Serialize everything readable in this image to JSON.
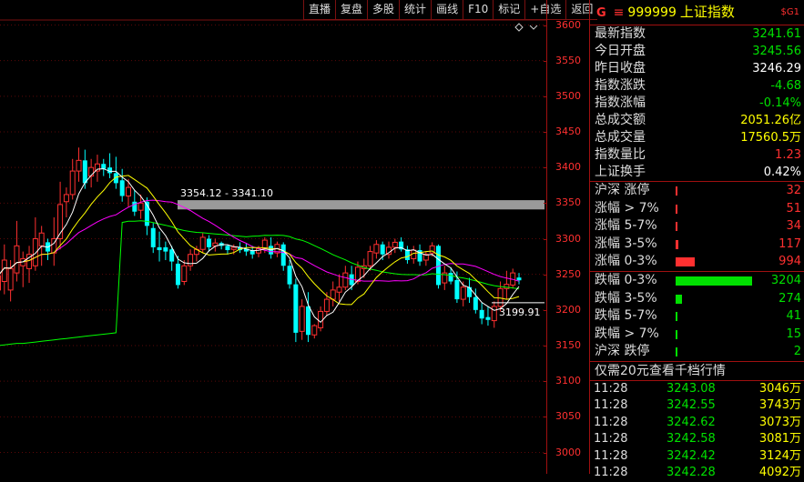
{
  "toolbar": [
    "直播",
    "复盘",
    "多股",
    "统计",
    "画线",
    "F10",
    "标记",
    "+自选",
    "返回"
  ],
  "header": {
    "g": "G",
    "eq": "≡",
    "code": "999999",
    "name": "上证指数",
    "tag": "$G1"
  },
  "quote": [
    {
      "label": "最新指数",
      "value": "3241.61",
      "color": "#00e000"
    },
    {
      "label": "今日开盘",
      "value": "3245.56",
      "color": "#00e000"
    },
    {
      "label": "昨日收盘",
      "value": "3246.29",
      "color": "#ffffff"
    },
    {
      "label": "指数涨跌",
      "value": "-4.68",
      "color": "#00e000"
    },
    {
      "label": "指数涨幅",
      "value": "-0.14%",
      "color": "#00e000"
    },
    {
      "label": "总成交额",
      "value": "2051.26亿",
      "color": "#ffff00"
    },
    {
      "label": "总成交量",
      "value": "17560.5万",
      "color": "#ffff00"
    },
    {
      "label": "指数量比",
      "value": "1.23",
      "color": "#ff3030"
    },
    {
      "label": "上证换手",
      "value": "0.42%",
      "color": "#ffffff"
    }
  ],
  "dist_up": [
    {
      "label": "沪深 涨停",
      "value": "32",
      "ratio": 0.0
    },
    {
      "label": "涨幅 > 7%",
      "value": "51",
      "ratio": 0.0
    },
    {
      "label": "涨幅 5-7%",
      "value": "34",
      "ratio": 0.0
    },
    {
      "label": "涨幅 3-5%",
      "value": "117",
      "ratio": 0.04
    },
    {
      "label": "涨幅 0-3%",
      "value": "994",
      "ratio": 0.25
    }
  ],
  "dist_down": [
    {
      "label": "跌幅 0-3%",
      "value": "3204",
      "ratio": 1.0
    },
    {
      "label": "跌幅 3-5%",
      "value": "274",
      "ratio": 0.08
    },
    {
      "label": "跌幅 5-7%",
      "value": "41",
      "ratio": 0.0
    },
    {
      "label": "跌幅 > 7%",
      "value": "15",
      "ratio": 0.0
    },
    {
      "label": "沪深 跌停",
      "value": "2",
      "ratio": 0.0
    }
  ],
  "banner": "仅需20元查看千档行情",
  "ticks": [
    {
      "time": "11:28",
      "price": "3243.08",
      "vol": "3046万"
    },
    {
      "time": "11:28",
      "price": "3242.55",
      "vol": "3743万"
    },
    {
      "time": "11:28",
      "price": "3242.62",
      "vol": "3073万"
    },
    {
      "time": "11:28",
      "price": "3242.58",
      "vol": "3081万"
    },
    {
      "time": "11:28",
      "price": "3242.42",
      "vol": "3124万"
    },
    {
      "time": "11:28",
      "price": "3242.28",
      "vol": "4092万"
    }
  ],
  "chart_data": {
    "type": "candlestick",
    "ylim": [
      2970,
      3630
    ],
    "y_ticks": [
      3000,
      3050,
      3100,
      3150,
      3200,
      3250,
      3300,
      3350,
      3400,
      3450,
      3500,
      3550,
      3600
    ],
    "band": {
      "label": "3354.12 - 3341.10",
      "high": 3354.12,
      "low": 3341.1
    },
    "last_low_label": "3199.91",
    "last_low": 3199.91,
    "colors": {
      "up": "#ff3030",
      "down": "#00ffff",
      "ma5": "#ffffff",
      "ma10": "#ffff00",
      "ma20": "#ff00ff",
      "ma60": "#00ff00"
    },
    "candles": [
      {
        "o": 3228,
        "h": 3262,
        "l": 3218,
        "c": 3248
      },
      {
        "o": 3240,
        "h": 3292,
        "l": 3222,
        "c": 3270
      },
      {
        "o": 3228,
        "h": 3270,
        "l": 3212,
        "c": 3258
      },
      {
        "o": 3252,
        "h": 3325,
        "l": 3240,
        "c": 3290
      },
      {
        "o": 3262,
        "h": 3282,
        "l": 3232,
        "c": 3272
      },
      {
        "o": 3258,
        "h": 3290,
        "l": 3238,
        "c": 3278
      },
      {
        "o": 3262,
        "h": 3330,
        "l": 3255,
        "c": 3300
      },
      {
        "o": 3290,
        "h": 3318,
        "l": 3262,
        "c": 3308
      },
      {
        "o": 3295,
        "h": 3300,
        "l": 3270,
        "c": 3282
      },
      {
        "o": 3280,
        "h": 3330,
        "l": 3262,
        "c": 3300
      },
      {
        "o": 3300,
        "h": 3380,
        "l": 3285,
        "c": 3348
      },
      {
        "o": 3352,
        "h": 3372,
        "l": 3330,
        "c": 3362
      },
      {
        "o": 3362,
        "h": 3412,
        "l": 3355,
        "c": 3395
      },
      {
        "o": 3395,
        "h": 3428,
        "l": 3380,
        "c": 3410
      },
      {
        "o": 3410,
        "h": 3425,
        "l": 3370,
        "c": 3378
      },
      {
        "o": 3388,
        "h": 3412,
        "l": 3372,
        "c": 3400
      },
      {
        "o": 3395,
        "h": 3418,
        "l": 3380,
        "c": 3405
      },
      {
        "o": 3405,
        "h": 3412,
        "l": 3388,
        "c": 3398
      },
      {
        "o": 3400,
        "h": 3420,
        "l": 3385,
        "c": 3392
      },
      {
        "o": 3392,
        "h": 3415,
        "l": 3370,
        "c": 3378
      },
      {
        "o": 3382,
        "h": 3398,
        "l": 3352,
        "c": 3360
      },
      {
        "o": 3360,
        "h": 3384,
        "l": 3345,
        "c": 3372
      },
      {
        "o": 3352,
        "h": 3368,
        "l": 3332,
        "c": 3338
      },
      {
        "o": 3340,
        "h": 3362,
        "l": 3328,
        "c": 3350
      },
      {
        "o": 3352,
        "h": 3358,
        "l": 3305,
        "c": 3318
      },
      {
        "o": 3315,
        "h": 3322,
        "l": 3280,
        "c": 3288
      },
      {
        "o": 3288,
        "h": 3310,
        "l": 3268,
        "c": 3284
      },
      {
        "o": 3288,
        "h": 3296,
        "l": 3270,
        "c": 3282
      },
      {
        "o": 3285,
        "h": 3290,
        "l": 3255,
        "c": 3268
      },
      {
        "o": 3265,
        "h": 3276,
        "l": 3230,
        "c": 3235
      },
      {
        "o": 3240,
        "h": 3270,
        "l": 3235,
        "c": 3262
      },
      {
        "o": 3262,
        "h": 3285,
        "l": 3255,
        "c": 3278
      },
      {
        "o": 3278,
        "h": 3290,
        "l": 3268,
        "c": 3285
      },
      {
        "o": 3285,
        "h": 3308,
        "l": 3280,
        "c": 3302
      },
      {
        "o": 3300,
        "h": 3305,
        "l": 3282,
        "c": 3288
      },
      {
        "o": 3290,
        "h": 3300,
        "l": 3282,
        "c": 3294
      },
      {
        "o": 3294,
        "h": 3296,
        "l": 3285,
        "c": 3290
      },
      {
        "o": 3290,
        "h": 3292,
        "l": 3278,
        "c": 3284
      },
      {
        "o": 3285,
        "h": 3292,
        "l": 3278,
        "c": 3288
      },
      {
        "o": 3288,
        "h": 3295,
        "l": 3280,
        "c": 3284
      },
      {
        "o": 3286,
        "h": 3294,
        "l": 3276,
        "c": 3282
      },
      {
        "o": 3284,
        "h": 3290,
        "l": 3272,
        "c": 3278
      },
      {
        "o": 3280,
        "h": 3290,
        "l": 3274,
        "c": 3286
      },
      {
        "o": 3286,
        "h": 3302,
        "l": 3280,
        "c": 3298
      },
      {
        "o": 3290,
        "h": 3302,
        "l": 3272,
        "c": 3278
      },
      {
        "o": 3280,
        "h": 3296,
        "l": 3274,
        "c": 3292
      },
      {
        "o": 3292,
        "h": 3295,
        "l": 3255,
        "c": 3262
      },
      {
        "o": 3262,
        "h": 3270,
        "l": 3230,
        "c": 3236
      },
      {
        "o": 3236,
        "h": 3244,
        "l": 3155,
        "c": 3168
      },
      {
        "o": 3170,
        "h": 3215,
        "l": 3158,
        "c": 3205
      },
      {
        "o": 3205,
        "h": 3225,
        "l": 3155,
        "c": 3165
      },
      {
        "o": 3165,
        "h": 3180,
        "l": 3160,
        "c": 3178
      },
      {
        "o": 3175,
        "h": 3205,
        "l": 3170,
        "c": 3198
      },
      {
        "o": 3198,
        "h": 3225,
        "l": 3192,
        "c": 3215
      },
      {
        "o": 3215,
        "h": 3240,
        "l": 3205,
        "c": 3228
      },
      {
        "o": 3225,
        "h": 3250,
        "l": 3212,
        "c": 3232
      },
      {
        "o": 3232,
        "h": 3262,
        "l": 3228,
        "c": 3252
      },
      {
        "o": 3250,
        "h": 3262,
        "l": 3228,
        "c": 3235
      },
      {
        "o": 3240,
        "h": 3268,
        "l": 3236,
        "c": 3260
      },
      {
        "o": 3258,
        "h": 3272,
        "l": 3245,
        "c": 3262
      },
      {
        "o": 3262,
        "h": 3290,
        "l": 3255,
        "c": 3282
      },
      {
        "o": 3280,
        "h": 3298,
        "l": 3272,
        "c": 3292
      },
      {
        "o": 3292,
        "h": 3296,
        "l": 3270,
        "c": 3278
      },
      {
        "o": 3278,
        "h": 3296,
        "l": 3272,
        "c": 3288
      },
      {
        "o": 3288,
        "h": 3300,
        "l": 3280,
        "c": 3295
      },
      {
        "o": 3296,
        "h": 3302,
        "l": 3282,
        "c": 3285
      },
      {
        "o": 3285,
        "h": 3290,
        "l": 3265,
        "c": 3270
      },
      {
        "o": 3272,
        "h": 3290,
        "l": 3265,
        "c": 3284
      },
      {
        "o": 3284,
        "h": 3292,
        "l": 3262,
        "c": 3268
      },
      {
        "o": 3270,
        "h": 3282,
        "l": 3262,
        "c": 3278
      },
      {
        "o": 3280,
        "h": 3295,
        "l": 3275,
        "c": 3290
      },
      {
        "o": 3290,
        "h": 3292,
        "l": 3230,
        "c": 3235
      },
      {
        "o": 3238,
        "h": 3262,
        "l": 3228,
        "c": 3252
      },
      {
        "o": 3252,
        "h": 3260,
        "l": 3236,
        "c": 3240
      },
      {
        "o": 3242,
        "h": 3254,
        "l": 3210,
        "c": 3215
      },
      {
        "o": 3215,
        "h": 3240,
        "l": 3205,
        "c": 3232
      },
      {
        "o": 3232,
        "h": 3245,
        "l": 3210,
        "c": 3218
      },
      {
        "o": 3218,
        "h": 3230,
        "l": 3195,
        "c": 3200
      },
      {
        "o": 3200,
        "h": 3210,
        "l": 3180,
        "c": 3188
      },
      {
        "o": 3190,
        "h": 3205,
        "l": 3178,
        "c": 3186
      },
      {
        "o": 3185,
        "h": 3212,
        "l": 3175,
        "c": 3205
      },
      {
        "o": 3205,
        "h": 3240,
        "l": 3198,
        "c": 3230
      },
      {
        "o": 3230,
        "h": 3255,
        "l": 3215,
        "c": 3236
      },
      {
        "o": 3235,
        "h": 3258,
        "l": 3230,
        "c": 3252
      },
      {
        "o": 3245.56,
        "h": 3252,
        "l": 3236,
        "c": 3241.61
      }
    ],
    "ma60_start": [
      3150,
      3151,
      3152,
      3153,
      3153,
      3154,
      3155,
      3156,
      3157,
      3158,
      3159,
      3160,
      3161,
      3162,
      3163,
      3164,
      3165,
      3166,
      3167,
      3168
    ]
  }
}
